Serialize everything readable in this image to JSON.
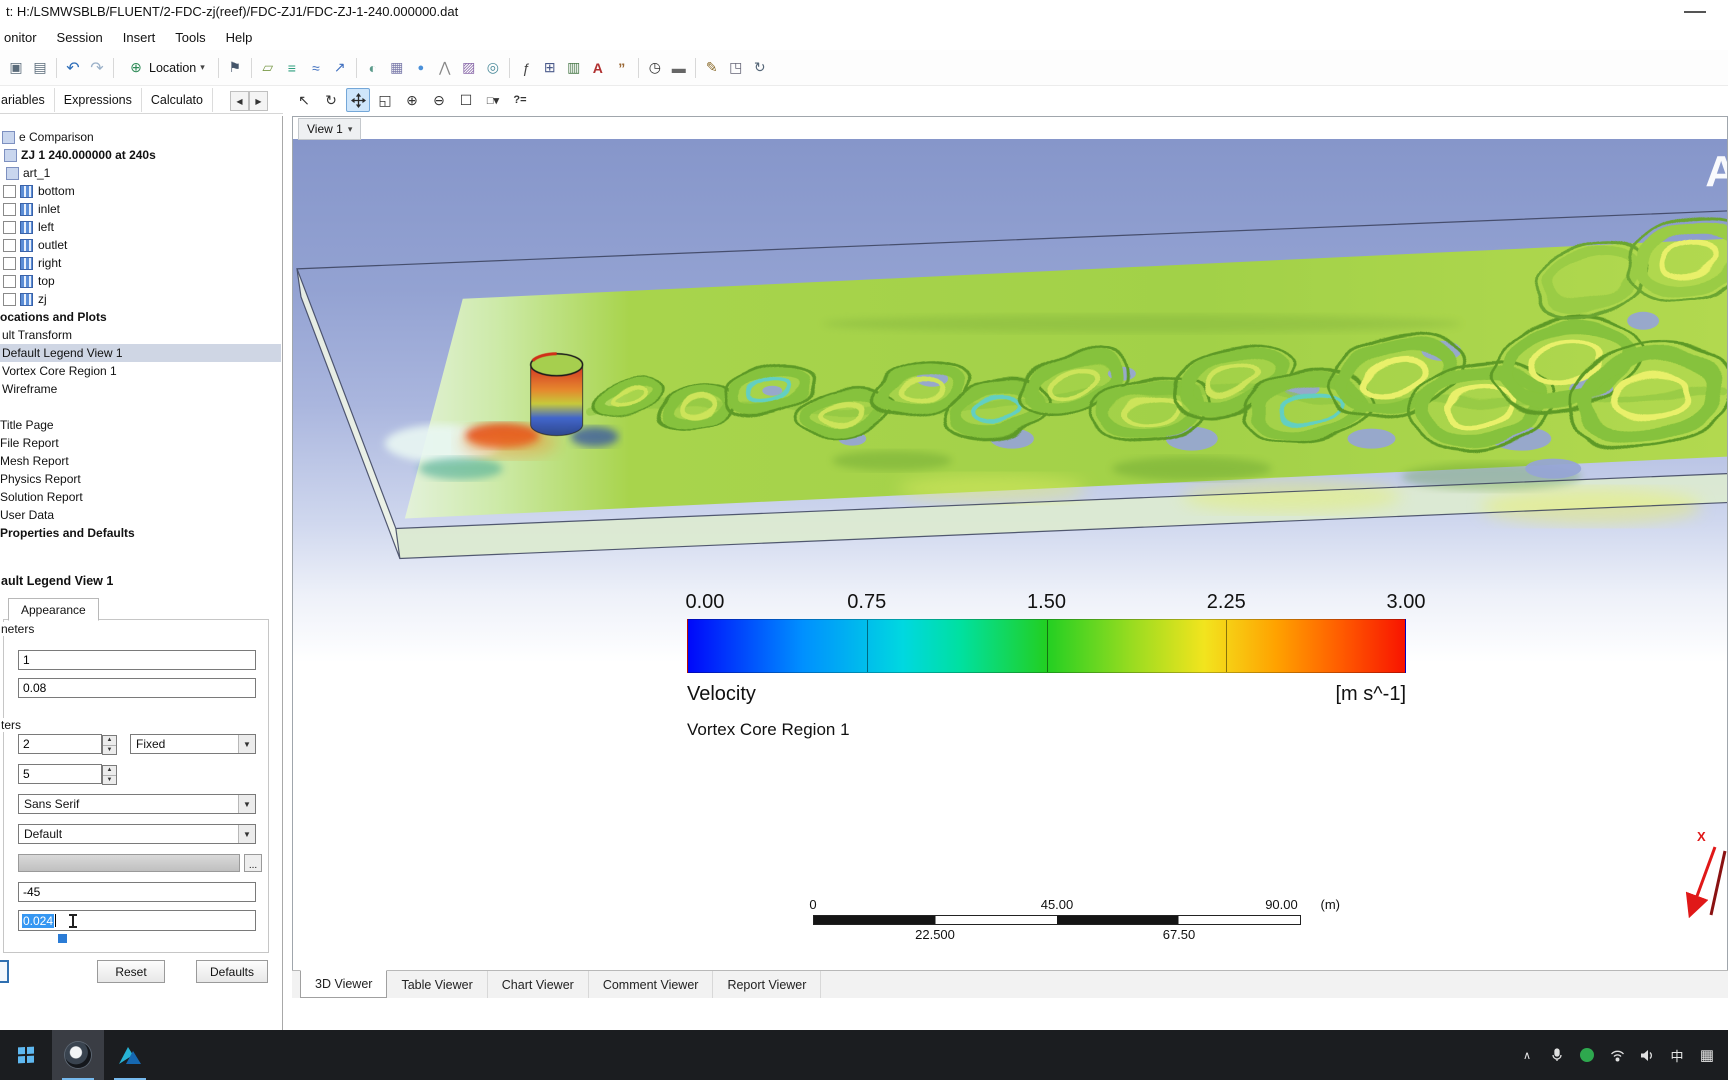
{
  "window": {
    "title": "t: H:/LSMWSBLB/FLUENT/2-FDC-zj(reef)/FDC-ZJ1/FDC-ZJ-1-240.000000.dat"
  },
  "menu": {
    "items": [
      "onitor",
      "Session",
      "Insert",
      "Tools",
      "Help"
    ]
  },
  "toolbar": {
    "location_label": "Location",
    "icons": [
      {
        "name": "snapshot-icon",
        "glyph": "▣"
      },
      {
        "name": "print-icon",
        "glyph": "▤"
      },
      {
        "name": "undo-icon",
        "glyph": "↶"
      },
      {
        "name": "redo-icon",
        "glyph": "↷"
      },
      {
        "name": "location-globe-icon",
        "glyph": "⊕"
      },
      {
        "name": "probe-flag-icon",
        "glyph": "⚑"
      },
      {
        "name": "plane-icon",
        "glyph": "▱"
      },
      {
        "name": "contour-icon",
        "glyph": "≡"
      },
      {
        "name": "streamline-icon",
        "glyph": "≈"
      },
      {
        "name": "vector-icon",
        "glyph": "↗"
      },
      {
        "name": "isosurface-icon",
        "glyph": "◐"
      },
      {
        "name": "volume-rendering-icon",
        "glyph": "▦"
      },
      {
        "name": "point-icon",
        "glyph": "●"
      },
      {
        "name": "polyline-icon",
        "glyph": "⋀"
      },
      {
        "name": "surface-group-icon",
        "glyph": "▨"
      },
      {
        "name": "turbo-surface-icon",
        "glyph": "◎"
      },
      {
        "name": "expression-icon",
        "glyph": "ƒ"
      },
      {
        "name": "table-icon",
        "glyph": "⊞"
      },
      {
        "name": "chart-icon",
        "glyph": "▥"
      },
      {
        "name": "text-label-icon",
        "glyph": "A"
      },
      {
        "name": "comment-icon",
        "glyph": "”"
      },
      {
        "name": "timestep-selector-icon",
        "glyph": "◷"
      },
      {
        "name": "animation-icon",
        "glyph": "▬"
      },
      {
        "name": "pencil-icon",
        "glyph": "✎"
      },
      {
        "name": "new-view-icon",
        "glyph": "◳"
      },
      {
        "name": "sync-views-icon",
        "glyph": "↻"
      }
    ]
  },
  "workspace_tabs": {
    "tabs": [
      "ariables",
      "Expressions",
      "Calculato"
    ],
    "scroll_left": "◀",
    "scroll_right": "▶"
  },
  "viewer_toolbar": {
    "icons": [
      {
        "name": "select-icon",
        "glyph": "↖"
      },
      {
        "name": "rotate-icon",
        "glyph": "↻"
      },
      {
        "name": "zoom-box-icon",
        "glyph": "◱"
      },
      {
        "name": "zoom-in-icon",
        "glyph": "⊕"
      },
      {
        "name": "zoom-out-icon",
        "glyph": "⊖"
      },
      {
        "name": "fit-view-icon",
        "glyph": "☐"
      },
      {
        "name": "render-options-icon",
        "glyph": "□▾"
      },
      {
        "name": "probe-what-icon",
        "glyph": "?="
      }
    ]
  },
  "tree": {
    "items": [
      {
        "label": "e Comparison"
      },
      {
        "label": "ZJ 1 240.000000 at 240s"
      },
      {
        "label": "art_1"
      },
      {
        "label": "bottom"
      },
      {
        "label": "inlet"
      },
      {
        "label": "left"
      },
      {
        "label": "outlet"
      },
      {
        "label": "right"
      },
      {
        "label": "top"
      },
      {
        "label": "zj"
      },
      {
        "label": "ocations and Plots"
      },
      {
        "label": "ult Transform"
      },
      {
        "label": "Default Legend View 1"
      },
      {
        "label": "Vortex Core Region 1"
      },
      {
        "label": "Wireframe"
      },
      {
        "label": "Title Page"
      },
      {
        "label": "File Report"
      },
      {
        "label": "Mesh Report"
      },
      {
        "label": "Physics Report"
      },
      {
        "label": "Solution Report"
      },
      {
        "label": "User Data"
      },
      {
        "label": "Properties and Defaults"
      }
    ]
  },
  "details": {
    "title": "ault Legend View 1",
    "tab_label": "Appearance",
    "group1_label": "neters",
    "group2_label": "ters",
    "field1": "1",
    "field2": "0.08",
    "precision_value": "2",
    "precision_mode": "Fixed",
    "value_ticks": "5",
    "font": "Sans Serif",
    "color_mode": "Default",
    "ellipsis_label": "...",
    "text_rotation": "-45",
    "text_height": "0.024",
    "reset_label": "Reset",
    "defaults_label": "Defaults"
  },
  "viewer": {
    "view_tab": "View 1",
    "watermark": "A",
    "legend": {
      "ticks": [
        "0.00",
        "0.75",
        "1.50",
        "2.25",
        "3.00"
      ],
      "title": "Velocity",
      "units": "[m s^-1]",
      "object": "Vortex Core Region 1"
    },
    "ruler": {
      "labels_top": [
        "0",
        "45.00",
        "90.00"
      ],
      "unit": "(m)",
      "labels_bottom": [
        "22.500",
        "67.50"
      ]
    },
    "triad_x": "X",
    "tabs": [
      "3D Viewer",
      "Table Viewer",
      "Chart Viewer",
      "Comment Viewer",
      "Report Viewer"
    ],
    "active_tab": "3D Viewer"
  },
  "taskbar": {
    "ime": "中",
    "chevron": "∧",
    "grid": "▦"
  },
  "colors": {
    "accent": "#3399ff",
    "selection_blue": "#3697f2",
    "surface_green": "#a8d44c",
    "legend_gradient": [
      "#0008fa",
      "#0090ff",
      "#00d8e0",
      "#22cf22",
      "#9adc20",
      "#f2e41e",
      "#ffa200",
      "#f81400"
    ]
  }
}
